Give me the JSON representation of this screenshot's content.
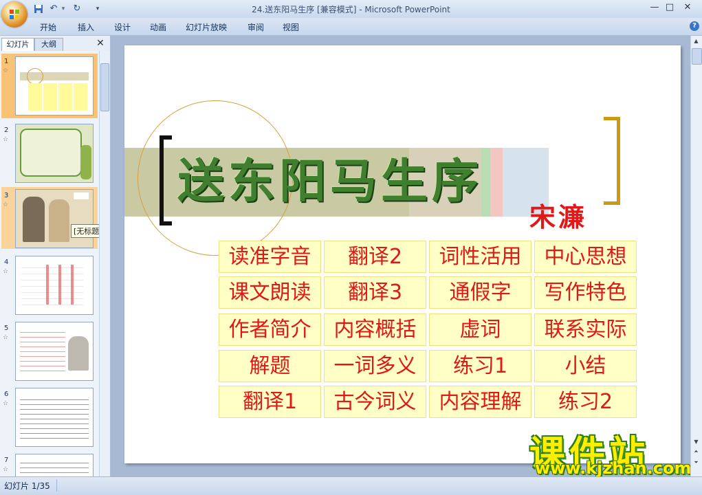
{
  "window": {
    "title": "24.送东阳马生序 [兼容模式] - Microsoft PowerPoint",
    "controls": [
      "—",
      "□",
      "✕"
    ]
  },
  "ribbon": {
    "tabs": [
      "开始",
      "插入",
      "设计",
      "动画",
      "幻灯片放映",
      "审阅",
      "视图"
    ]
  },
  "left_panel": {
    "tab_slides": "幻灯片",
    "tab_outline": "大纲",
    "slide_numbers": [
      "1",
      "2",
      "3",
      "4",
      "5",
      "6",
      "7"
    ],
    "tooltip": "[无标题]"
  },
  "slide": {
    "title": "送东阳马生序",
    "author": "宋濂",
    "buttons": [
      [
        "读准字音",
        "翻译2",
        "词性活用",
        "中心思想"
      ],
      [
        "课文朗读",
        "翻译3",
        "通假字",
        "写作特色"
      ],
      [
        "作者简介",
        "内容概括",
        "虚词",
        "联系实际"
      ],
      [
        "解题",
        "一词多义",
        "练习1",
        "小结"
      ],
      [
        "翻译1",
        "古今词义",
        "内容理解",
        "练习2"
      ]
    ]
  },
  "watermark": {
    "logo": "课件站",
    "url": "www.kjzhan.com"
  },
  "status": {
    "slide_position": "幻灯片 1/35"
  },
  "colors": {
    "button_text": "#e01818",
    "button_bg": "#ffffc6",
    "title_green": "#3f7f2f",
    "selected_thumb": "#f8c374"
  }
}
